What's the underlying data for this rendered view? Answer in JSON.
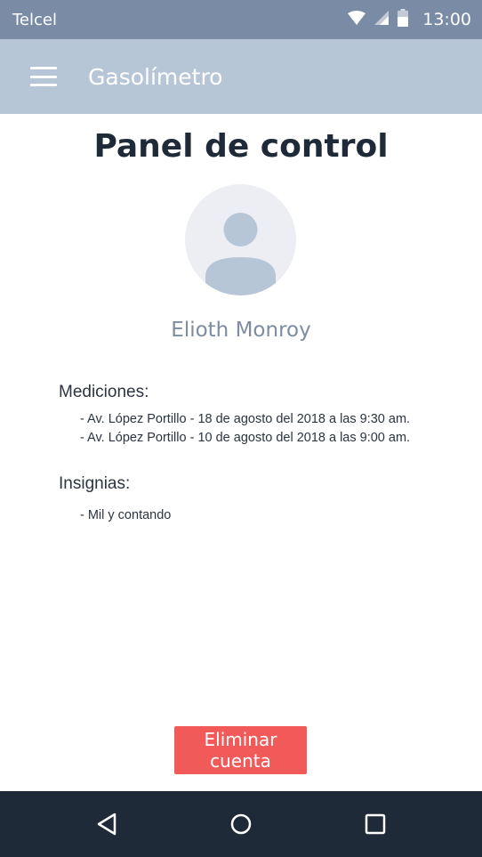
{
  "status_bar": {
    "carrier": "Telcel",
    "time": "13:00",
    "icons": [
      "wifi-icon",
      "signal-icon",
      "battery-icon"
    ]
  },
  "app_bar": {
    "title": "Gasolímetro",
    "menu_icon": "menu-icon"
  },
  "dashboard": {
    "title": "Panel de control",
    "avatar_icon": "avatar-placeholder-icon",
    "user_name": "Elioth Monroy",
    "measurements": {
      "heading": "Mediciones:",
      "items": [
        "- Av. López Portillo - 18 de agosto del 2018 a las 9:30 am.",
        "- Av. López Portillo - 10 de agosto del 2018 a las 9:00 am."
      ]
    },
    "badges": {
      "heading": "Insignias:",
      "items": [
        "- Mil y contando"
      ]
    },
    "delete_button": "Eliminar cuenta"
  },
  "nav_bar": {
    "buttons": [
      "back-icon",
      "home-icon",
      "recents-icon"
    ]
  },
  "colors": {
    "status_bar": "#7a8ba5",
    "app_bar": "#b7c6d6",
    "danger": "#f25a5a",
    "nav_bar": "#1f2a38"
  }
}
